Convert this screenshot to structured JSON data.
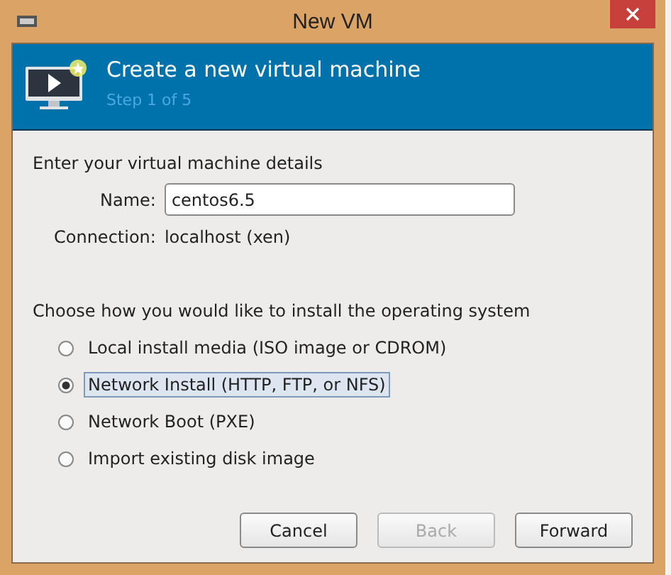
{
  "window": {
    "title": "New VM"
  },
  "header": {
    "title": "Create a new virtual machine",
    "step": "Step 1 of 5"
  },
  "details": {
    "heading": "Enter your virtual machine details",
    "name_label": "Name:",
    "name_value": "centos6.5",
    "connection_label": "Connection:",
    "connection_value": "localhost (xen)"
  },
  "install": {
    "heading": "Choose how you would like to install the operating system",
    "options": [
      {
        "label": "Local install media (ISO image or CDROM)",
        "selected": false
      },
      {
        "label": "Network Install (HTTP, FTP, or NFS)",
        "selected": true
      },
      {
        "label": "Network Boot (PXE)",
        "selected": false
      },
      {
        "label": "Import existing disk image",
        "selected": false
      }
    ]
  },
  "buttons": [
    {
      "label": "Cancel",
      "disabled": false
    },
    {
      "label": "Back",
      "disabled": true
    },
    {
      "label": "Forward",
      "disabled": false
    }
  ]
}
